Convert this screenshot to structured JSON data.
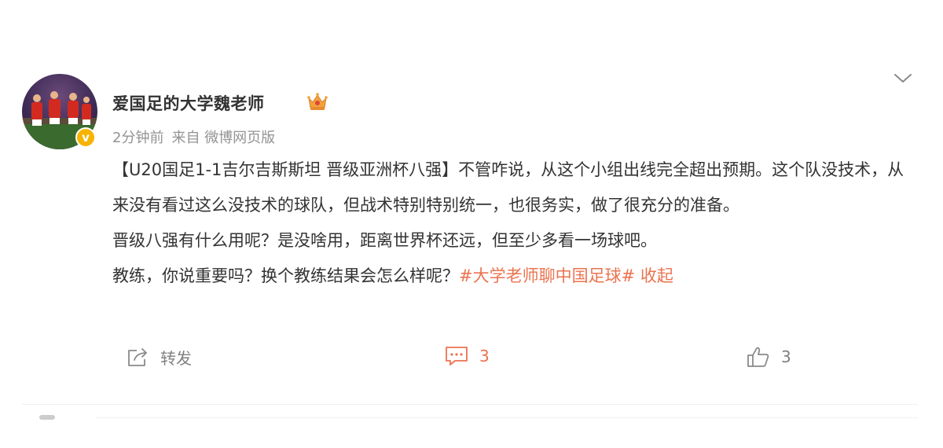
{
  "post": {
    "author": {
      "name": "爱国足的大学魏老师",
      "verified_symbol": "v",
      "badge_icon": "crown-icon"
    },
    "meta": {
      "time": "2分钟前",
      "source_prefix": "来自",
      "source": "微博网页版"
    },
    "content": {
      "paragraph1": "【U20国足1-1吉尔吉斯斯坦 晋级亚洲杯八强】不管咋说，从这个小组出线完全超出预期。这个队没技术，从来没有看过这么没技术的球队，但战术特别特别统一，也很务实，做了很充分的准备。",
      "paragraph2": "晋级八强有什么用呢？是没啥用，距离世界杯还远，但至少多看一场球吧。",
      "paragraph3": "教练，你说重要吗？换个教练结果会怎么样呢？",
      "hashtag": "#大学老师聊中国足球#",
      "collapse": "收起"
    },
    "actions": {
      "repost_label": "转发",
      "comment_count": "3",
      "like_count": "3"
    }
  },
  "colors": {
    "accent": "#eb7350",
    "text": "#333333",
    "muted": "#939393",
    "verified": "#f6b400"
  }
}
